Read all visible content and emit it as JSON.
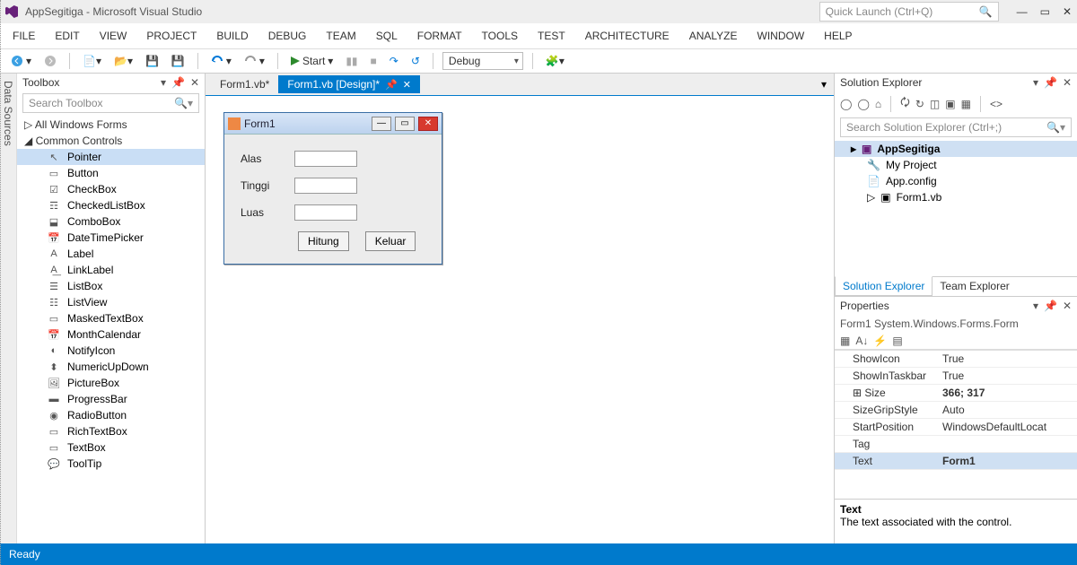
{
  "titlebar": {
    "title": "AppSegitiga - Microsoft Visual Studio",
    "quick_launch": "Quick Launch (Ctrl+Q)"
  },
  "menu": [
    "FILE",
    "EDIT",
    "VIEW",
    "PROJECT",
    "BUILD",
    "DEBUG",
    "TEAM",
    "SQL",
    "FORMAT",
    "TOOLS",
    "TEST",
    "ARCHITECTURE",
    "ANALYZE",
    "WINDOW",
    "HELP"
  ],
  "toolbar": {
    "start": "Start",
    "config": "Debug"
  },
  "side_tab": "Data Sources",
  "toolbox": {
    "title": "Toolbox",
    "search_placeholder": "Search Toolbox",
    "categories": [
      {
        "label": "All Windows Forms",
        "expanded": false
      },
      {
        "label": "Common Controls",
        "expanded": true
      }
    ],
    "items": [
      "Pointer",
      "Button",
      "CheckBox",
      "CheckedListBox",
      "ComboBox",
      "DateTimePicker",
      "Label",
      "LinkLabel",
      "ListBox",
      "ListView",
      "MaskedTextBox",
      "MonthCalendar",
      "NotifyIcon",
      "NumericUpDown",
      "PictureBox",
      "ProgressBar",
      "RadioButton",
      "RichTextBox",
      "TextBox",
      "ToolTip"
    ],
    "selected": 0
  },
  "tabs": [
    {
      "label": "Form1.vb*",
      "active": false
    },
    {
      "label": "Form1.vb [Design]*",
      "active": true
    }
  ],
  "form": {
    "title": "Form1",
    "fields": [
      {
        "label": "Alas"
      },
      {
        "label": "Tinggi"
      },
      {
        "label": "Luas"
      }
    ],
    "buttons": [
      "Hitung",
      "Keluar"
    ]
  },
  "solution_explorer": {
    "title": "Solution Explorer",
    "search_placeholder": "Search Solution Explorer (Ctrl+;)",
    "root": "AppSegitiga",
    "items": [
      "My Project",
      "App.config",
      "Form1.vb"
    ],
    "tabs": [
      "Solution Explorer",
      "Team Explorer"
    ]
  },
  "properties": {
    "title": "Properties",
    "object": "Form1",
    "type": "System.Windows.Forms.Form",
    "rows": [
      {
        "k": "ShowIcon",
        "v": "True"
      },
      {
        "k": "ShowInTaskbar",
        "v": "True"
      },
      {
        "k": "Size",
        "v": "366; 317",
        "bold": true,
        "expand": true
      },
      {
        "k": "SizeGripStyle",
        "v": "Auto"
      },
      {
        "k": "StartPosition",
        "v": "WindowsDefaultLocat"
      },
      {
        "k": "Tag",
        "v": ""
      },
      {
        "k": "Text",
        "v": "Form1",
        "bold": true,
        "sel": true
      }
    ],
    "desc_title": "Text",
    "desc_body": "The text associated with the control."
  },
  "statusbar": "Ready"
}
